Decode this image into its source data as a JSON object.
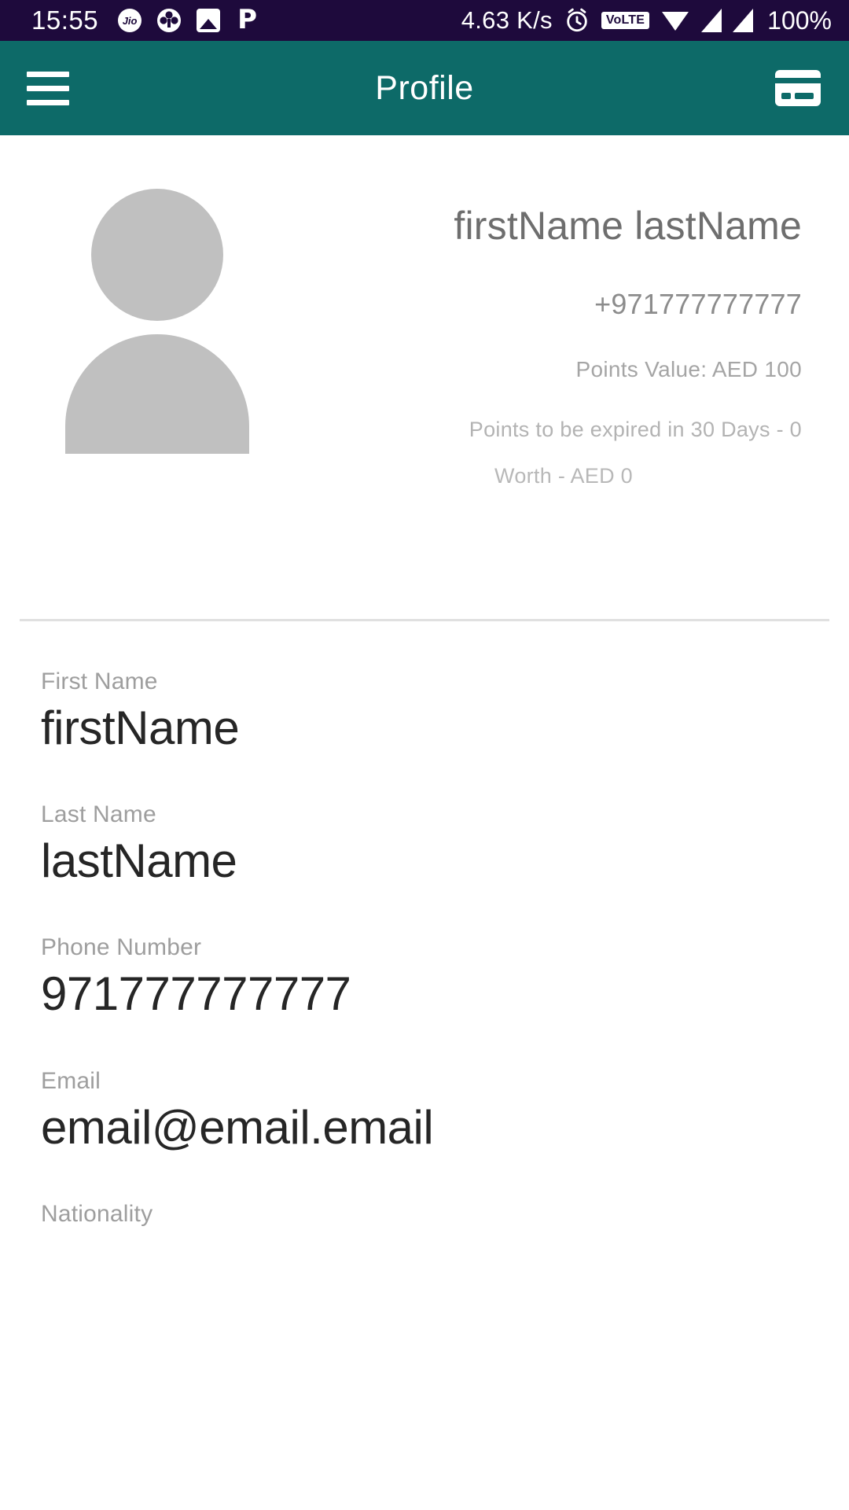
{
  "status_bar": {
    "time": "15:55",
    "network_speed": "4.63 K/s",
    "volte": "VoLTE",
    "battery": "100%",
    "notification_icons": [
      "jio-icon",
      "clubs-icon",
      "photo-icon",
      "p-app-icon"
    ],
    "right_icons": [
      "alarm-clock-icon",
      "volte-icon",
      "wifi-icon",
      "signal-icon-1",
      "signal-icon-2"
    ],
    "background_color": "#1e0a3c"
  },
  "app_bar": {
    "title": "Profile",
    "menu_icon": "hamburger-menu-icon",
    "action_icon": "card-icon",
    "background_color": "#0d6a68"
  },
  "profile": {
    "avatar_icon": "person-placeholder-icon",
    "name": "firstName lastName",
    "phone": "+971777777777",
    "points_value": "Points Value: AED 100",
    "points_expiry": "Points to be expired in 30 Days - 0",
    "points_worth": "Worth - AED 0"
  },
  "form": {
    "fields": [
      {
        "label": "First Name",
        "value": "firstName"
      },
      {
        "label": "Last Name",
        "value": "lastName"
      },
      {
        "label": "Phone Number",
        "value": "971777777777"
      },
      {
        "label": "Email",
        "value": "email@email.email"
      },
      {
        "label": "Nationality",
        "value": ""
      }
    ]
  }
}
